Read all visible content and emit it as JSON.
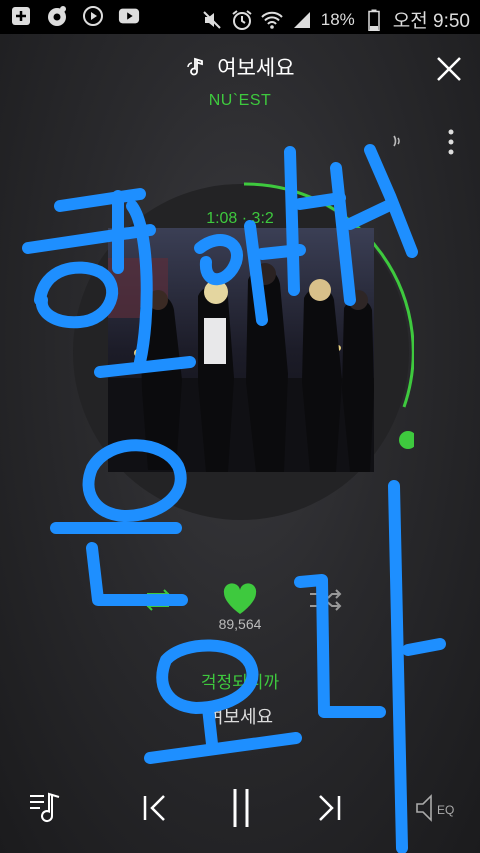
{
  "status_bar": {
    "battery": "18%",
    "time": "오전 9:50",
    "left_icons": [
      "add-box-icon",
      "music-app-icon",
      "play-circle-icon",
      "youtube-icon"
    ],
    "right_icons": [
      "mute-icon",
      "alarm-icon",
      "wifi-icon",
      "signal-icon",
      "battery-icon"
    ]
  },
  "player": {
    "song_title": "여보세요",
    "artist": "NU`EST",
    "time_display": "1:08 · 3:2",
    "like_count": "89,564",
    "lyric_current": "걱정되니까",
    "lyric_next": "여보세요"
  },
  "overlay_annotation": {
    "handwritten_text": "취향은 오다",
    "color": "#1e8fff"
  },
  "colors": {
    "accent": "#3ec93e",
    "background": "#2a2a2d"
  }
}
